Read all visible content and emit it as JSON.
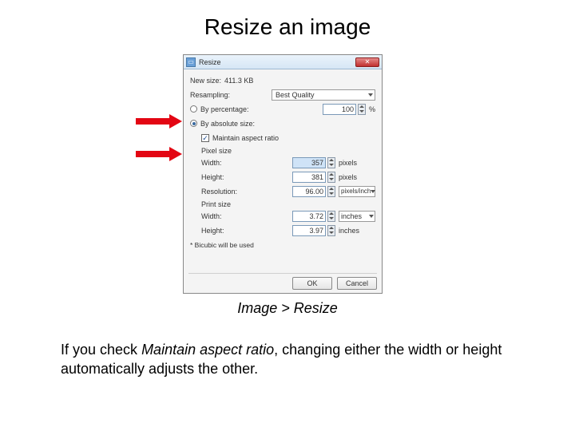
{
  "slide": {
    "title": "Resize an image",
    "caption": "Image > Resize",
    "paragraph_pre": "If you check ",
    "paragraph_em": "Maintain aspect ratio",
    "paragraph_post": ", changing either the width or height automatically adjusts the other."
  },
  "dialog": {
    "title": "Resize",
    "close_glyph": "✕",
    "new_size_label": "New size:",
    "new_size_value": "411.3 KB",
    "resampling_label": "Resampling:",
    "resampling_value": "Best Quality",
    "radio_percentage": "By percentage:",
    "radio_absolute": "By absolute size:",
    "percentage_value": "100",
    "percentage_unit": "%",
    "maintain_aspect": "Maintain aspect ratio",
    "pixel_size_section": "Pixel size",
    "width_label": "Width:",
    "height_label": "Height:",
    "resolution_label": "Resolution:",
    "width_value": "357",
    "height_value": "381",
    "pixels_unit": "pixels",
    "resolution_value": "96.00",
    "resolution_unit": "pixels/inch",
    "print_size_section": "Print size",
    "print_width_value": "3.72",
    "print_height_value": "3.97",
    "inches_unit": "inches",
    "footnote": "* Bicubic will be used",
    "ok": "OK",
    "cancel": "Cancel",
    "check_glyph": "✓"
  }
}
